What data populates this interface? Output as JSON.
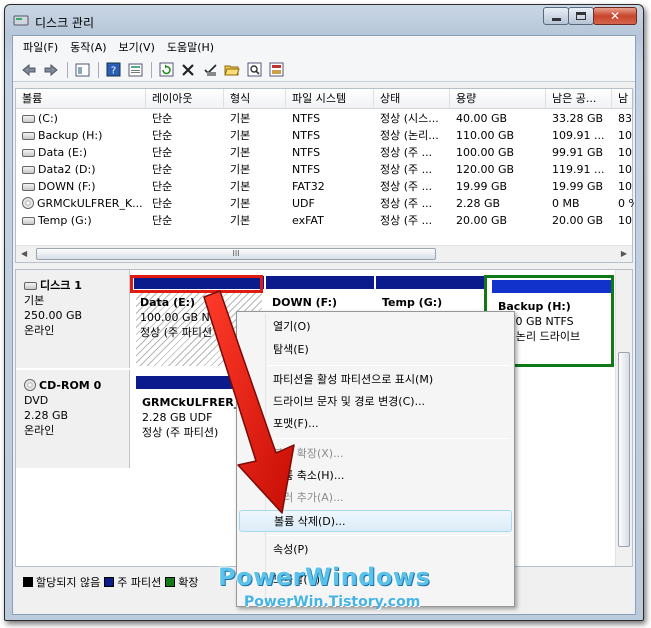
{
  "window": {
    "title": "디스크 관리"
  },
  "menubar": [
    "파일(F)",
    "동작(A)",
    "보기(V)",
    "도움말(H)"
  ],
  "toolbar": [
    "back-icon",
    "forward-icon",
    "view-icon",
    "help-icon",
    "properties-icon",
    "refresh-icon",
    "delete-icon",
    "checklist-icon",
    "open-folder-icon",
    "search-icon",
    "wizard-icon"
  ],
  "volumes": {
    "headers": [
      "볼륨",
      "레이아웃",
      "형식",
      "파일 시스템",
      "상태",
      "용량",
      "남은 공...",
      "남"
    ],
    "rows": [
      {
        "icon": "drive-icon",
        "cells": [
          "(C:)",
          "단순",
          "기본",
          "NTFS",
          "정상 (시스...",
          "40.00 GB",
          "33.28 GB",
          "83"
        ]
      },
      {
        "icon": "drive-icon",
        "cells": [
          "Backup (H:)",
          "단순",
          "기본",
          "NTFS",
          "정상 (논리...",
          "110.00 GB",
          "109.91 ...",
          "10"
        ]
      },
      {
        "icon": "drive-icon",
        "cells": [
          "Data (E:)",
          "단순",
          "기본",
          "NTFS",
          "정상 (주 ...",
          "100.00 GB",
          "99.91 GB",
          "10"
        ]
      },
      {
        "icon": "drive-icon",
        "cells": [
          "Data2 (D:)",
          "단순",
          "기본",
          "NTFS",
          "정상 (주 ...",
          "120.00 GB",
          "119.91 ...",
          "10"
        ]
      },
      {
        "icon": "drive-icon",
        "cells": [
          "DOWN (F:)",
          "단순",
          "기본",
          "FAT32",
          "정상 (주 ...",
          "19.99 GB",
          "19.99 GB",
          "10"
        ]
      },
      {
        "icon": "cd-icon",
        "cells": [
          "GRMCkULFRER_K...",
          "단순",
          "기본",
          "UDF",
          "정상 (주 ...",
          "2.28 GB",
          "0 MB",
          "0 %"
        ]
      },
      {
        "icon": "drive-icon",
        "cells": [
          "Temp (G:)",
          "단순",
          "기본",
          "exFAT",
          "정상 (주 ...",
          "20.00 GB",
          "20.00 GB",
          "10"
        ]
      }
    ],
    "scroll_grip": "III"
  },
  "disks": [
    {
      "name": "디스크 1",
      "type": "기본",
      "size": "250.00 GB",
      "state": "온라인",
      "partitions": [
        {
          "name": "Data  (E:)",
          "size": "100.00 GB NTFS",
          "status": "정상 (주 파티션"
        },
        {
          "name": "DOWN  (F:)",
          "size": "",
          "status": ""
        },
        {
          "name": "Temp  (G:)",
          "size": "",
          "status": ""
        },
        {
          "name": "Backup  (H:)",
          "size": "0.00 GB NTFS",
          "status": "상 (논리 드라이브"
        }
      ]
    },
    {
      "name": "CD-ROM 0",
      "type": "DVD",
      "size": "2.28 GB",
      "state": "온라인",
      "partitions": [
        {
          "name": "GRMCkULFRER_K",
          "size": "2.28 GB UDF",
          "status": "정상 (주 파티션)"
        }
      ]
    }
  ],
  "legend": {
    "unallocated": "할당되지 않음",
    "primary": "주 파티션",
    "extended": "확장"
  },
  "context_menu": {
    "items": [
      {
        "label": "열기(O)",
        "disabled": false
      },
      {
        "label": "탐색(E)",
        "disabled": false
      },
      {
        "label": "파티션을 활성 파티션으로 표시(M)",
        "disabled": false
      },
      {
        "label": "드라이브 문자 및 경로 변경(C)...",
        "disabled": false
      },
      {
        "label": "포맷(F)...",
        "disabled": false
      },
      {
        "label": "볼륨 확장(X)...",
        "disabled": true
      },
      {
        "label": "볼륨 축소(H)...",
        "disabled": false
      },
      {
        "label": "미러 추가(A)...",
        "disabled": true
      },
      {
        "label": "볼륨 삭제(D)...",
        "disabled": false,
        "highlighted": true
      },
      {
        "label": "속성(P)",
        "disabled": false
      },
      {
        "label": "도움말(H)",
        "disabled": false
      }
    ]
  },
  "watermark": {
    "brand": "PowerWindows",
    "site": "PowerWin.Tistory.com"
  },
  "colors": {
    "primary_partition": "#0b1b8c",
    "annotation_red": "#e01c12",
    "extended_green": "#0f7a17",
    "watermark_blue": "#5bc3ea"
  }
}
